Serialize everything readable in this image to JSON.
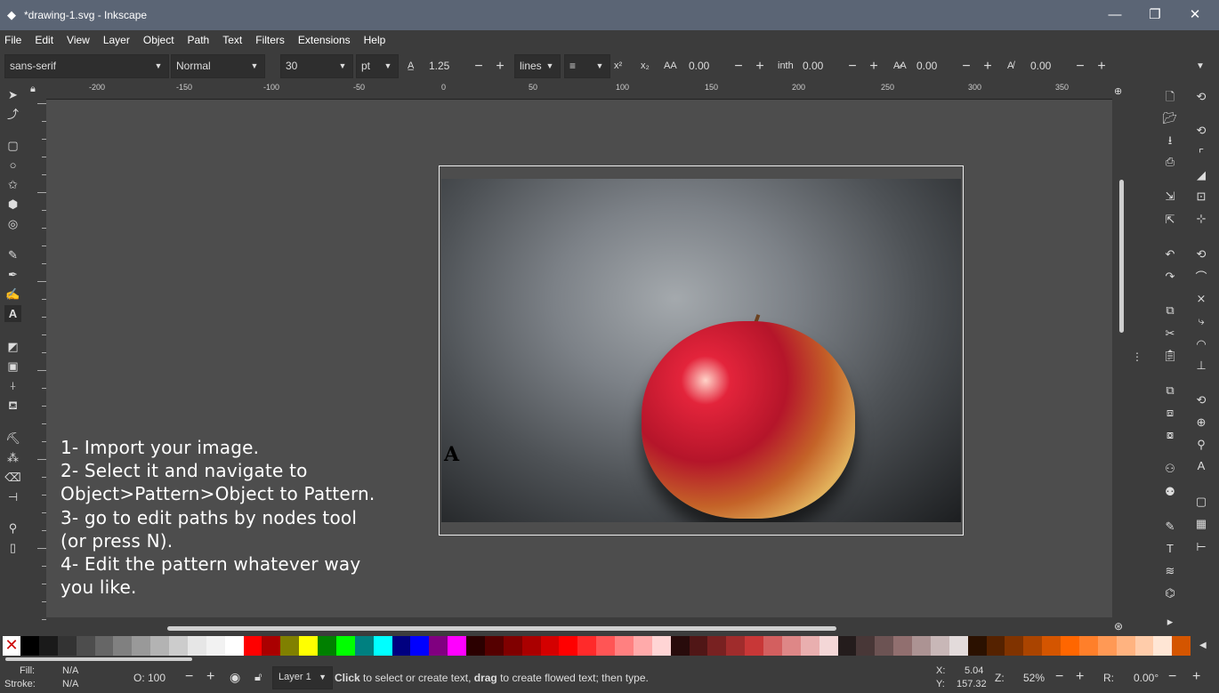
{
  "window": {
    "title": "*drawing-1.svg - Inkscape",
    "minimize": "—",
    "maximize": "❐",
    "close": "✕"
  },
  "menu": [
    "File",
    "Edit",
    "View",
    "Layer",
    "Object",
    "Path",
    "Text",
    "Filters",
    "Extensions",
    "Help"
  ],
  "text_toolbar": {
    "font_family": "sans-serif",
    "font_style": "Normal",
    "font_size": "30",
    "unit": "pt",
    "line_height": "1.25",
    "line_height_unit": "lines",
    "letter_spacing": "0.00",
    "word_spacing_label": "inth",
    "word_spacing": "0.00",
    "kerning": "0.00",
    "rotation": "0.00"
  },
  "ruler": {
    "h_ticks": [
      "-200",
      "-150",
      "-100",
      "-50",
      "0",
      "50",
      "100",
      "150",
      "200",
      "250",
      "300",
      "350"
    ]
  },
  "canvas_text": [
    "1- Import your image.",
    "2- Select it and navigate to",
    "Object>Pattern>Object to Pattern.",
    "3- go to edit paths by nodes tool",
    "(or press N).",
    "4- Edit the pattern whatever way",
    "you like."
  ],
  "palette": [
    "#000000",
    "#1a1a1a",
    "#333333",
    "#4d4d4d",
    "#666666",
    "#808080",
    "#999999",
    "#b3b3b3",
    "#cccccc",
    "#e6e6e6",
    "#f2f2f2",
    "#ffffff",
    "#ff0000",
    "#aa0000",
    "#808000",
    "#ffff00",
    "#008000",
    "#00ff00",
    "#008080",
    "#00ffff",
    "#000080",
    "#0000ff",
    "#800080",
    "#ff00ff",
    "#2b0000",
    "#550000",
    "#800000",
    "#aa0000",
    "#d40000",
    "#ff0000",
    "#ff2a2a",
    "#ff5555",
    "#ff8080",
    "#ffaaaa",
    "#ffd5d5",
    "#280b0b",
    "#501616",
    "#782121",
    "#a02c2c",
    "#c83737",
    "#d35f5f",
    "#de8787",
    "#e9afaf",
    "#f4d7d7",
    "#241c1c",
    "#483737",
    "#6c5353",
    "#916f6f",
    "#ac9393",
    "#c8b7b7",
    "#e3dbdb",
    "#2b1100",
    "#552200",
    "#803300",
    "#aa4400",
    "#d45500",
    "#ff6600",
    "#ff7f2a",
    "#ff9955",
    "#ffb380",
    "#ffccaa",
    "#ffe6d5",
    "#d45500"
  ],
  "status": {
    "fill_label": "Fill:",
    "fill_value": "N/A",
    "stroke_label": "Stroke:",
    "stroke_value": "N/A",
    "opacity_label": "O:",
    "opacity_value": "100",
    "layer": "Layer 1",
    "message_bold1": "Click",
    "message_mid": " to select or create text, ",
    "message_bold2": "drag",
    "message_end": " to create flowed text; then type.",
    "x_label": "X:",
    "x_value": "5.04",
    "y_label": "Y:",
    "y_value": "157.32",
    "zoom_label": "Z:",
    "zoom_value": "52%",
    "rotate_label": "R:",
    "rotate_value": "0.00°"
  }
}
